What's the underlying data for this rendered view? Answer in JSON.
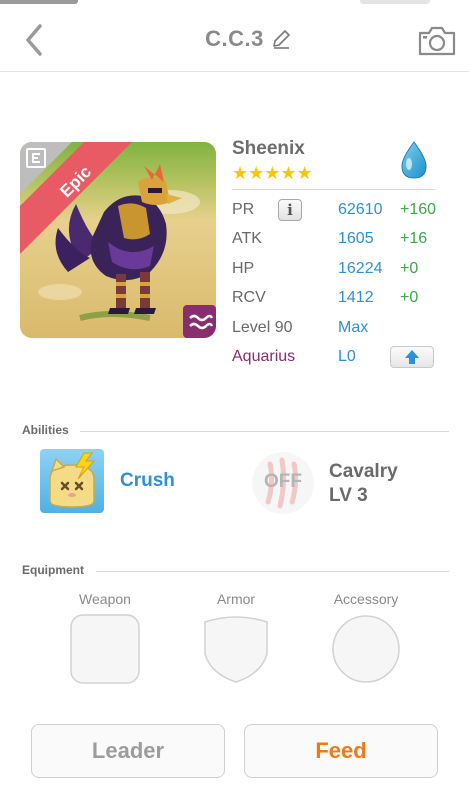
{
  "header": {
    "title": "C.C.3",
    "back_icon": "chevron-left-icon",
    "edit_icon": "pencil-icon",
    "camera_icon": "camera-icon"
  },
  "card": {
    "rarity": "Epic",
    "corner_icon": "e-letter-icon",
    "element_badge_icon": "wave-icon",
    "name": "Sheenix",
    "stars": "★★★★★",
    "star_count": 5,
    "element_icon": "water-drop-icon",
    "stats": [
      {
        "label": "PR",
        "value": "62610",
        "bonus": "+160"
      },
      {
        "label": "ATK",
        "value": "1605",
        "bonus": "+16"
      },
      {
        "label": "HP",
        "value": "16224",
        "bonus": "+0"
      },
      {
        "label": "RCV",
        "value": "1412",
        "bonus": "+0"
      }
    ],
    "info_button": "i",
    "level_label": "Level 90",
    "level_value": "Max",
    "zodiac_label": "Aquarius",
    "zodiac_value": "L0",
    "upgrade_icon": "arrow-up-icon"
  },
  "abilities": {
    "section_title": "Abilities",
    "ability_name": "Crush",
    "ability_icon": "crush-cat-icon",
    "skill_status": "OFF",
    "skill_name_line1": "Cavalry",
    "skill_name_line2": "LV 3"
  },
  "equipment": {
    "section_title": "Equipment",
    "slots": [
      {
        "label": "Weapon"
      },
      {
        "label": "Armor"
      },
      {
        "label": "Accessory"
      }
    ]
  },
  "actions": {
    "leader_label": "Leader",
    "feed_label": "Feed"
  },
  "colors": {
    "accent_blue": "#2f8fd8",
    "bonus_green": "#3aa845",
    "zodiac_purple": "#8a2d6e",
    "feed_orange": "#f07a18",
    "epic_ribbon": "#e85a64"
  }
}
